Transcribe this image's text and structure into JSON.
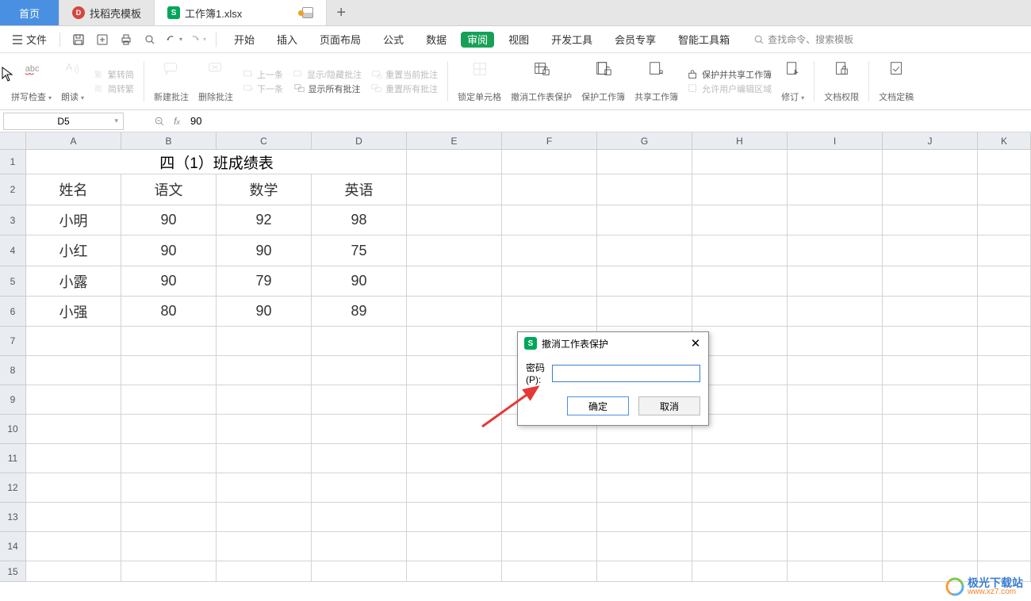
{
  "tabs": {
    "home": "首页",
    "docshell": "找稻壳模板",
    "workbook": "工作簿1.xlsx",
    "plus": "+"
  },
  "quick": {
    "file": "文件"
  },
  "menus": [
    "开始",
    "插入",
    "页面布局",
    "公式",
    "数据",
    "审阅",
    "视图",
    "开发工具",
    "会员专享",
    "智能工具箱"
  ],
  "search_placeholder": "查找命令、搜索模板",
  "ribbon": {
    "spellcheck": "拼写检查",
    "read": "朗读",
    "fztj": "繁转简",
    "jtf": "简转繁",
    "newcomment": "新建批注",
    "delcomment": "删除批注",
    "prev": "上一条",
    "next": "下一条",
    "showhide": "显示/隐藏批注",
    "showall": "显示所有批注",
    "resetcur": "重置当前批注",
    "resetall": "重置所有批注",
    "lockcell": "锁定单元格",
    "unprotect": "撤消工作表保护",
    "protectwb": "保护工作簿",
    "sharewb": "共享工作簿",
    "protectshare": "保护并共享工作簿",
    "allowedit": "允许用户编辑区域",
    "revisions": "修订",
    "docperm": "文档权限",
    "docdraft": "文档定稿"
  },
  "namebox": "D5",
  "formula": "90",
  "columns": [
    "A",
    "B",
    "C",
    "D",
    "E",
    "F",
    "G",
    "H",
    "I",
    "J",
    "K"
  ],
  "row_count": 15,
  "title_cell": "四（1）班成绩表",
  "headers": [
    "姓名",
    "语文",
    "数学",
    "英语"
  ],
  "data": [
    [
      "小明",
      "90",
      "92",
      "98"
    ],
    [
      "小红",
      "90",
      "90",
      "75"
    ],
    [
      "小露",
      "90",
      "79",
      "90"
    ],
    [
      "小强",
      "80",
      "90",
      "89"
    ]
  ],
  "dialog": {
    "title": "撤消工作表保护",
    "label": "密码(P):",
    "ok": "确定",
    "cancel": "取消"
  },
  "watermark": {
    "text": "极光下载站",
    "url": "www.xz7.com"
  }
}
